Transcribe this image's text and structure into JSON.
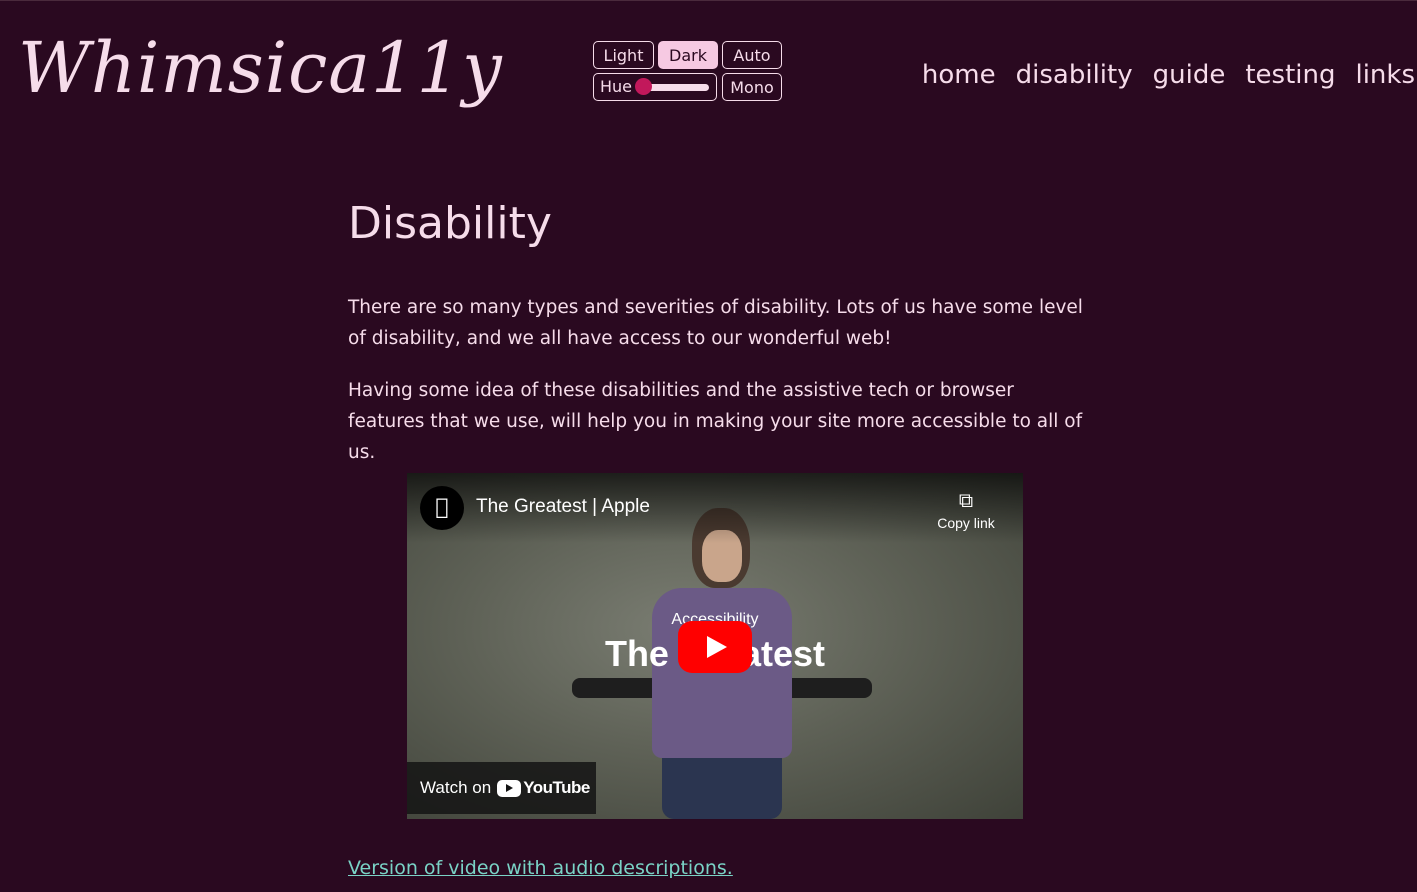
{
  "header": {
    "logo_text": "Whimsica11y",
    "theme": {
      "light_label": "Light",
      "dark_label": "Dark",
      "auto_label": "Auto",
      "hue_label": "Hue",
      "mono_label": "Mono",
      "active": "Dark",
      "hue_value_fraction": 0.0
    },
    "nav": [
      {
        "label": "home"
      },
      {
        "label": "disability"
      },
      {
        "label": "guide"
      },
      {
        "label": "testing"
      },
      {
        "label": "links"
      }
    ]
  },
  "main": {
    "title": "Disability",
    "paragraphs": [
      "There are so many types and severities of disability. Lots of us have some level of disability, and we all have access to our wonderful web!",
      "Having some idea of these disabilities and the assistive tech or browser features that we use, will help you in making your site more accessible to all of us."
    ],
    "video": {
      "title": "The Greatest | Apple",
      "copy_link_label": "Copy link",
      "overlay_small": "Accessibility",
      "overlay_large": "The Greatest",
      "watch_on_label": "Watch on",
      "youtube_label": "YouTube"
    },
    "audio_description_link": "Version of video with audio descriptions."
  },
  "colors": {
    "background": "#2a0920",
    "text": "#f6dcea",
    "active_button": "#f6c9e2",
    "hue_thumb": "#c2185b",
    "link": "#7ad3c6",
    "play_button": "#ff0000"
  }
}
